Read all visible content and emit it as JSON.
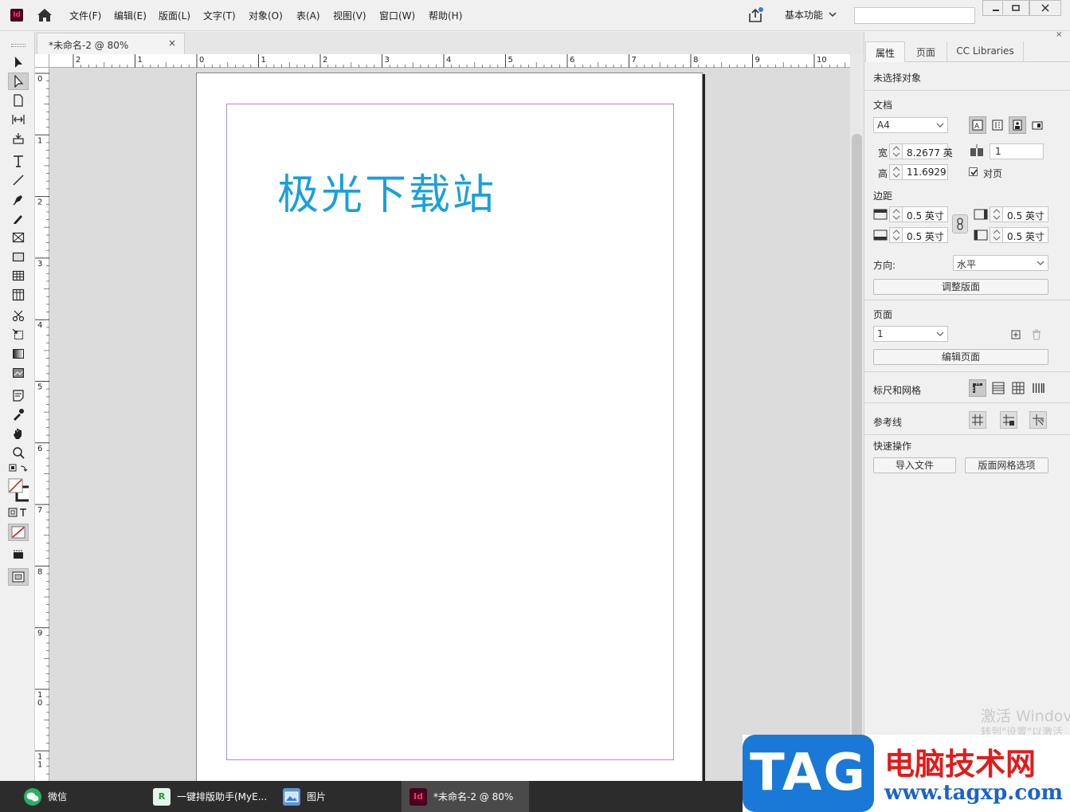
{
  "menu": {
    "items": [
      "文件(F)",
      "编辑(E)",
      "版面(L)",
      "文字(T)",
      "对象(O)",
      "表(A)",
      "视图(V)",
      "窗口(W)",
      "帮助(H)"
    ],
    "app_icon": "Id",
    "workspace": "基本功能"
  },
  "document": {
    "tab_label": "*未命名-2 @ 80%",
    "tab_close": "×",
    "page_text": "极光下载站"
  },
  "rulers": {
    "h_labels": [
      "2",
      "1",
      "0",
      "1",
      "2",
      "3",
      "4",
      "5",
      "6",
      "7",
      "8",
      "9",
      "10"
    ],
    "v_labels": [
      "0",
      "1",
      "2",
      "3",
      "4",
      "5",
      "6",
      "7",
      "8",
      "9",
      "1\n0",
      "1\n1"
    ]
  },
  "panel": {
    "close": "×",
    "tabs": [
      "属性",
      "页面",
      "CC Libraries"
    ],
    "selection_status": "未选择对象",
    "document_section": "文档",
    "page_size": "A4",
    "width_label": "宽",
    "width_value": "8.2677 英",
    "height_label": "高",
    "height_value": "11.6929",
    "pages_value": "1",
    "facing_pages": "对页",
    "margins_section": "边距",
    "margin_top": "0.5 英寸",
    "margin_bottom": "0.5 英寸",
    "margin_left": "0.5 英寸",
    "margin_right": "0.5 英寸",
    "orientation_label": "方向:",
    "orientation_value": "水平",
    "adjust_layout": "调整版面",
    "page_section": "页面",
    "page_select": "1",
    "edit_page": "编辑页面",
    "rulers_grids": "标尺和网格",
    "guides": "参考线",
    "quick_actions": "快速操作",
    "import_file": "导入文件",
    "layout_grid_options": "版面网格选项"
  },
  "watermark": {
    "line1": "激活 Windov",
    "line2": "转到\"设置\"以激活"
  },
  "taskbar": {
    "items": [
      {
        "label": "微信",
        "icon": "wechat-icon"
      },
      {
        "label": "一键排版助手(MyE...",
        "icon": "typeset-helper-icon"
      },
      {
        "label": "图片",
        "icon": "photos-icon"
      },
      {
        "label": "*未命名-2 @ 80%",
        "icon": "indesign-icon"
      }
    ]
  },
  "logo": {
    "tag": "TAG",
    "title": "电脑技术网",
    "url": "www.tagxp.com"
  },
  "colors": {
    "page_text": "#1aa0dc",
    "margin_guide": "#c67bd1",
    "indesign_brand": "#49021f",
    "tag_blue": "#1a79d6",
    "tag_red": "#e21b1b"
  }
}
